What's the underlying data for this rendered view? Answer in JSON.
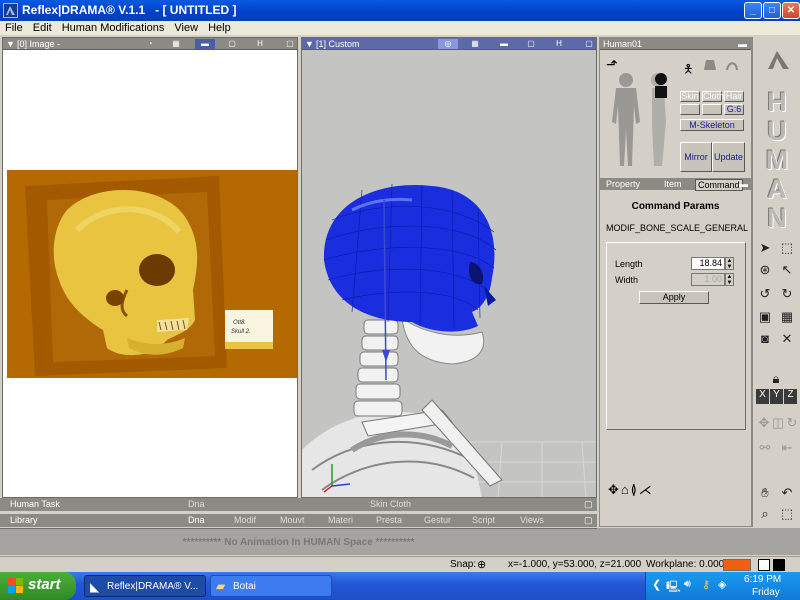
{
  "window": {
    "title": "Reflex|DRAMA® V.1.1   - [ UNTITLED ]",
    "minimize": "_",
    "maximize": "□",
    "close": "✕"
  },
  "menu": [
    "File",
    "Edit",
    "Human Modifications",
    "View",
    "Help"
  ],
  "image_pane": {
    "header": "[0] Image -",
    "header_buttons": [
      "◔",
      "▦",
      "▬",
      "▢",
      "H"
    ],
    "label_card_line1": "Ott8.",
    "label_card_line2": "Skull 2."
  },
  "view_pane": {
    "header": "[1] Custom",
    "header_buttons": [
      "◎",
      "▦",
      "▬",
      "▢",
      "H"
    ]
  },
  "right_panel": {
    "header": "Human01",
    "buttons": {
      "skin": "Skin",
      "cloth": "Cloth",
      "hair": "Hair",
      "g6": "G:6",
      "m_skeleton": "M-Skeleton",
      "mirror": "Mirror",
      "update": "Update"
    },
    "tabs": [
      "Property",
      "Item",
      "Command"
    ],
    "active_tab": "Command",
    "command_title": "Command Params",
    "command_name": "MODIF_BONE_SCALE_GENERAL",
    "length_label": "Length",
    "length_value": "18.84",
    "width_label": "Width",
    "width_value": "1.00",
    "apply": "Apply"
  },
  "human_logo": [
    "H",
    "U",
    "M",
    "A",
    "N"
  ],
  "bottom_tabs": {
    "row1": {
      "title": "Human Task",
      "tabs": [
        "Dna",
        "Skin Cloth"
      ]
    },
    "row2": {
      "title": "Library",
      "tabs": [
        "Dna",
        "Modif",
        "Mouvt",
        "Materi",
        "Presta",
        "Gestur",
        "Script",
        "Views"
      ]
    }
  },
  "animation_message": "********** No Animation In HUMAN Space **********",
  "status": {
    "snap": "Snap:",
    "coords": "x=-1.000, y=53.000, z=21.000",
    "workplane": "Workplane: 0.000",
    "workplane_color": "#f06010"
  },
  "taskbar": {
    "start": "start",
    "tasks": [
      "Reflex|DRAMA® V...",
      "Botai"
    ],
    "clock": "6:19 PM",
    "day": "Friday"
  },
  "colors": {
    "photo_bg": "#b56a00",
    "skull": "#e8c440",
    "head_mesh": "#1a2ee0",
    "viewport_bg": "#c4c4c2"
  }
}
